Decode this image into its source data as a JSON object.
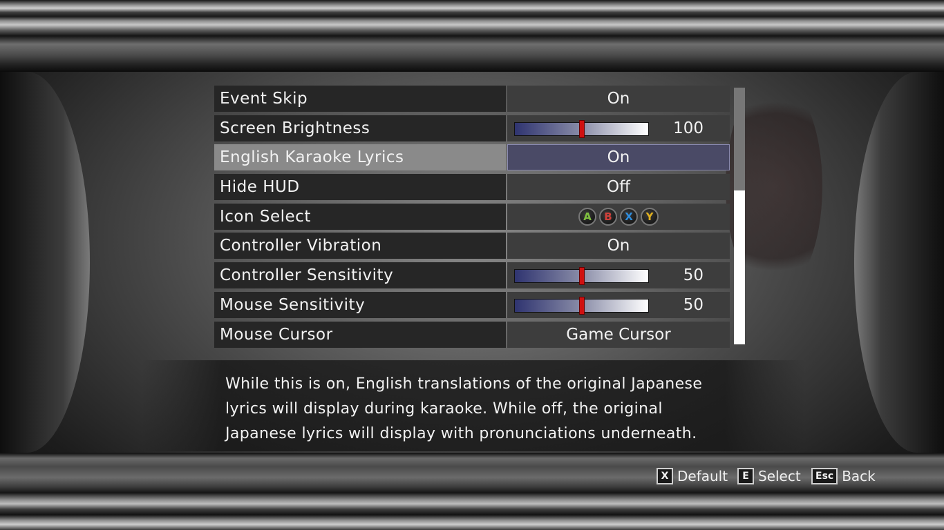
{
  "options": [
    {
      "label": "Event Skip",
      "type": "text",
      "value": "On"
    },
    {
      "label": "Screen Brightness",
      "type": "slider",
      "value": "100",
      "level": 0.5
    },
    {
      "label": "English Karaoke Lyrics",
      "type": "text",
      "value": "On",
      "selected": true
    },
    {
      "label": "Hide HUD",
      "type": "text",
      "value": "Off"
    },
    {
      "label": "Icon Select",
      "type": "icons",
      "icons": [
        "A",
        "B",
        "X",
        "Y"
      ]
    },
    {
      "label": "Controller Vibration",
      "type": "text",
      "value": "On"
    },
    {
      "label": "Controller Sensitivity",
      "type": "slider",
      "value": "50",
      "level": 0.5
    },
    {
      "label": "Mouse Sensitivity",
      "type": "slider",
      "value": "50",
      "level": 0.5
    },
    {
      "label": "Mouse Cursor",
      "type": "text",
      "value": "Game Cursor"
    }
  ],
  "icon_colors": {
    "A": "#7fbf3f",
    "B": "#d0403a",
    "X": "#2f8fe0",
    "Y": "#e0b020"
  },
  "description": {
    "line1": "While this is on, English translations of the original Japanese",
    "line2": "lyrics will display during karaoke. While off, the original",
    "line3": "Japanese lyrics will display with pronunciations underneath."
  },
  "hints": {
    "default_key": "X",
    "default_label": "Default",
    "select_key": "E",
    "select_label": "Select",
    "back_key": "Esc",
    "back_label": "Back"
  },
  "scrollbar": {
    "position": 0.0,
    "visible_fraction": 0.4
  }
}
